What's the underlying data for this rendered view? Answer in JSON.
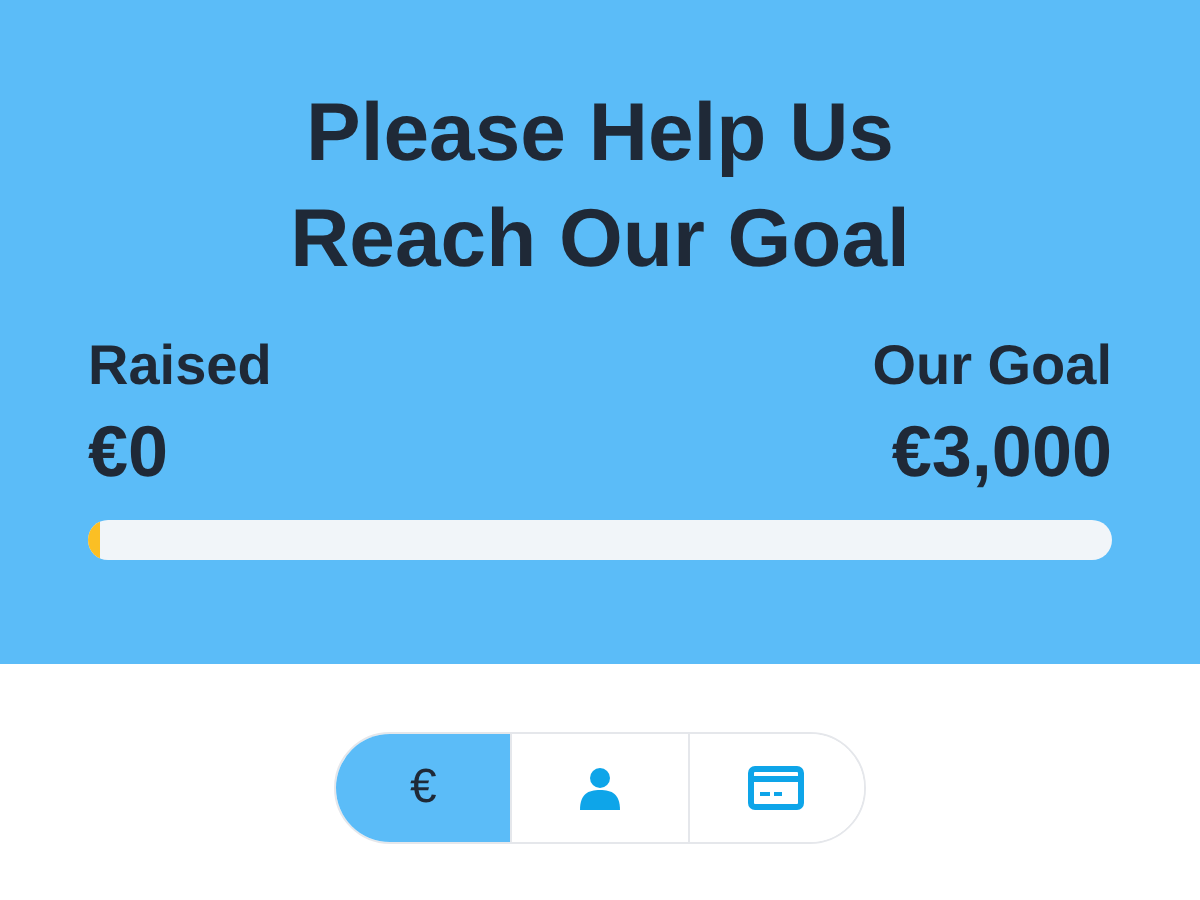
{
  "title": "Please Help Us Reach Our Goal",
  "raised": {
    "label": "Raised",
    "amount": "€0"
  },
  "goal": {
    "label": "Our Goal",
    "amount": "€3,000"
  },
  "progress": {
    "level": 0.012
  },
  "steps": [
    {
      "kind": "text",
      "text": "€",
      "selected": true
    },
    {
      "kind": "person",
      "selected": false
    },
    {
      "kind": "card",
      "selected": false
    }
  ]
}
